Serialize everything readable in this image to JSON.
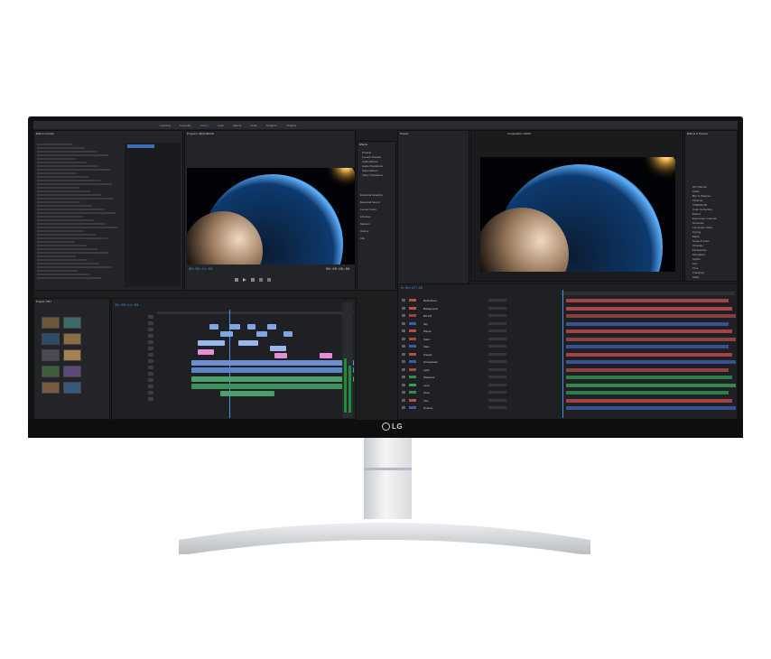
{
  "brand": {
    "logo_text": "LG"
  },
  "premiere": {
    "menu_items": [
      "Learning",
      "Assembly",
      "Editing",
      "Color",
      "Effects",
      "Audio",
      "Graphics",
      "Libraries"
    ],
    "active_menu": "Editing",
    "effect_controls_title": "Effect Controls",
    "program_title": "Program: SEQUENCE",
    "program_timecode": "00:00:11:03",
    "program_duration": "00:00:26:06",
    "sequence_timecode": "00:00:11:03",
    "project_title": "Project: PRJ",
    "effects_title": "Effects",
    "effects_items": [
      "Presets",
      "Lumetri Presets",
      "Audio Effects",
      "Audio Transitions",
      "Video Effects",
      "Video Transitions"
    ],
    "effects_bottom": [
      "Essential Graphics",
      "Essential Sound",
      "Lumetri Color",
      "Libraries",
      "Markers",
      "History",
      "Info"
    ]
  },
  "after_effects": {
    "composition_title": "Composition: MAIN",
    "project_title": "Project",
    "timeline_timecode": "0;00;27;26",
    "effects_presets_title": "Effects & Presets",
    "effects_list": [
      "3D Channel",
      "Audio",
      "Blur & Sharpen",
      "Channel",
      "CINEMA 4D",
      "Color Correction",
      "Distort",
      "Expression Controls",
      "Generate",
      "Immersive Video",
      "Keying",
      "Matte",
      "Noise & Grain",
      "Obsolete",
      "Perspective",
      "Simulation",
      "Stylize",
      "Text",
      "Time",
      "Transition",
      "Utility"
    ],
    "layers": [
      "Reflections",
      "Background",
      "BG Fill",
      "Sky",
      "Planet",
      "Stars",
      "Flare",
      "Clouds",
      "Atmosphere",
      "Light",
      "Shadows",
      "Lens",
      "Glow",
      "Title",
      "Overlay"
    ]
  }
}
